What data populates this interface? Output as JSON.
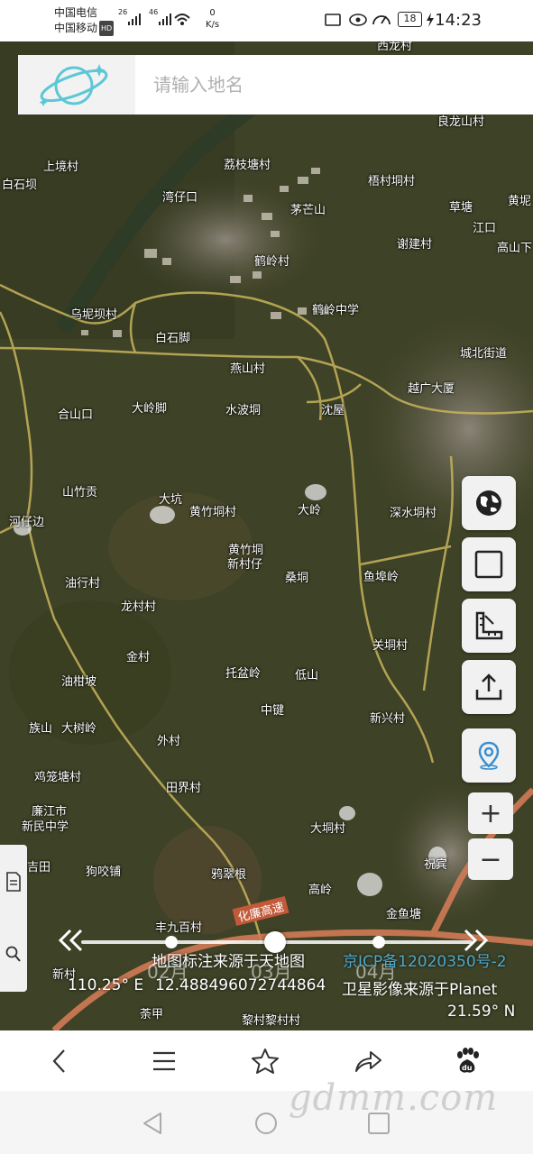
{
  "status_bar": {
    "carrier_1": "中国电信",
    "carrier_2": "中国移动",
    "hd_badge": "HD",
    "signal_1": "26",
    "signal_2": "46",
    "speed_value": "0",
    "speed_unit": "K/s",
    "battery": "18",
    "time": "14:23"
  },
  "search": {
    "placeholder": "请输入地名"
  },
  "map_labels": [
    "西龙村",
    "良龙山村",
    "上境村",
    "荔枝塘村",
    "白石坝",
    "梧村垌村",
    "黄坭",
    "湾仔口",
    "茅芒山",
    "草塘",
    "江口",
    "谢建村",
    "高山下",
    "鹤岭村",
    "乌坭坝村",
    "鹤岭中学",
    "白石脚",
    "城北街道",
    "燕山村",
    "越广大厦",
    "大岭脚",
    "水波垌",
    "合山口",
    "沈屋",
    "山竹贡",
    "大坑",
    "深水垌村",
    "黄竹垌村",
    "大岭",
    "河仔边",
    "黄竹垌",
    "新村仔",
    "桑垌",
    "鱼埠岭",
    "油行村",
    "龙村村",
    "关垌村",
    "金村",
    "托盆岭",
    "低山",
    "油柑坡",
    "中键",
    "新兴村",
    "族山",
    "大树岭",
    "外村",
    "鸡笼塘村",
    "田界村",
    "廉江市",
    "新民中学",
    "大垌村",
    "狗咬铺",
    "吉田",
    "鸦翠根",
    "高岭",
    "祝宾",
    "化廉高速",
    "丰九百村",
    "金鱼塘",
    "新村",
    "黎村黎村村",
    "荼甲"
  ],
  "timeline": {
    "months": [
      "02月",
      "03月",
      "04月"
    ]
  },
  "info": {
    "annotation_source": "地图标注来源于天地图",
    "icp": "京ICP备12020350号-2",
    "longitude": "110.25° E",
    "center_value": "12.488496072744864",
    "imagery_source": "卫星影像来源于Planet",
    "latitude": "21.59° N"
  },
  "zoom": {
    "in": "+",
    "out": "−"
  },
  "watermark": "gdmm.com",
  "colors": {
    "road": "#c8b45c",
    "highway_label": "#c25a3a",
    "icp_link": "#4fa9c9",
    "logo_accent": "#5cc7d6"
  }
}
